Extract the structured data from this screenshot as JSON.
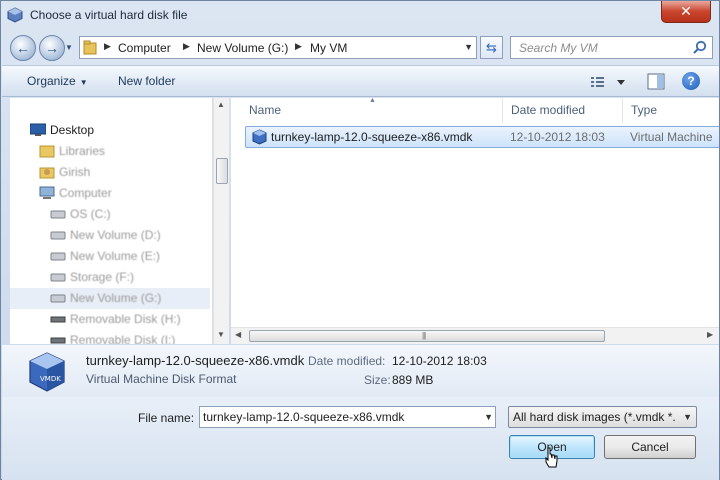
{
  "window": {
    "title": "Choose a virtual hard disk file",
    "close_label": "✕"
  },
  "address": {
    "crumbs": [
      "Computer",
      "New Volume (G:)",
      "My VM"
    ],
    "search_placeholder": "Search My VM"
  },
  "toolbar": {
    "organize_label": "Organize",
    "new_folder_label": "New folder",
    "help_label": "?"
  },
  "nav": {
    "items": [
      {
        "label": "Desktop",
        "icon": "desktop-icon",
        "blurred": false,
        "selected": false
      },
      {
        "label": "Libraries",
        "icon": "library-icon",
        "blurred": true,
        "selected": false
      },
      {
        "label": "Girish",
        "icon": "user-folder-icon",
        "blurred": true,
        "selected": false
      },
      {
        "label": "Computer",
        "icon": "computer-icon",
        "blurred": true,
        "selected": false
      },
      {
        "label": "OS (C:)",
        "icon": "drive-icon",
        "blurred": true,
        "selected": false
      },
      {
        "label": "New Volume (D:)",
        "icon": "drive-icon",
        "blurred": true,
        "selected": false
      },
      {
        "label": "New Volume (E:)",
        "icon": "drive-icon",
        "blurred": true,
        "selected": false
      },
      {
        "label": "Storage (F:)",
        "icon": "drive-icon",
        "blurred": true,
        "selected": false
      },
      {
        "label": "New Volume (G:)",
        "icon": "drive-icon",
        "blurred": true,
        "selected": true
      },
      {
        "label": "Removable Disk (H:)",
        "icon": "removable-drive-icon",
        "blurred": true,
        "selected": false
      },
      {
        "label": "Removable Disk (I:)",
        "icon": "removable-drive-icon",
        "blurred": true,
        "selected": false
      }
    ]
  },
  "files": {
    "columns": [
      "Name",
      "Date modified",
      "Type"
    ],
    "rows": [
      {
        "name": "turnkey-lamp-12.0-squeeze-x86.vmdk",
        "date": "12-10-2012 18:03",
        "type": "Virtual Machine"
      }
    ]
  },
  "details": {
    "name": "turnkey-lamp-12.0-squeeze-x86.vmdk",
    "type": "Virtual Machine Disk Format",
    "date_label": "Date modified:",
    "date_value": "12-10-2012 18:03",
    "size_label": "Size:",
    "size_value": "889 MB"
  },
  "form": {
    "file_name_label": "File name:",
    "file_name_value": "turnkey-lamp-12.0-squeeze-x86.vmdk",
    "filter_value": "All hard disk images (*.vmdk *.vdi",
    "open_label": "Open",
    "cancel_label": "Cancel"
  },
  "colors": {
    "accent": "#3c7fb1",
    "selection": "#cde3fb",
    "close": "#c9452e"
  }
}
